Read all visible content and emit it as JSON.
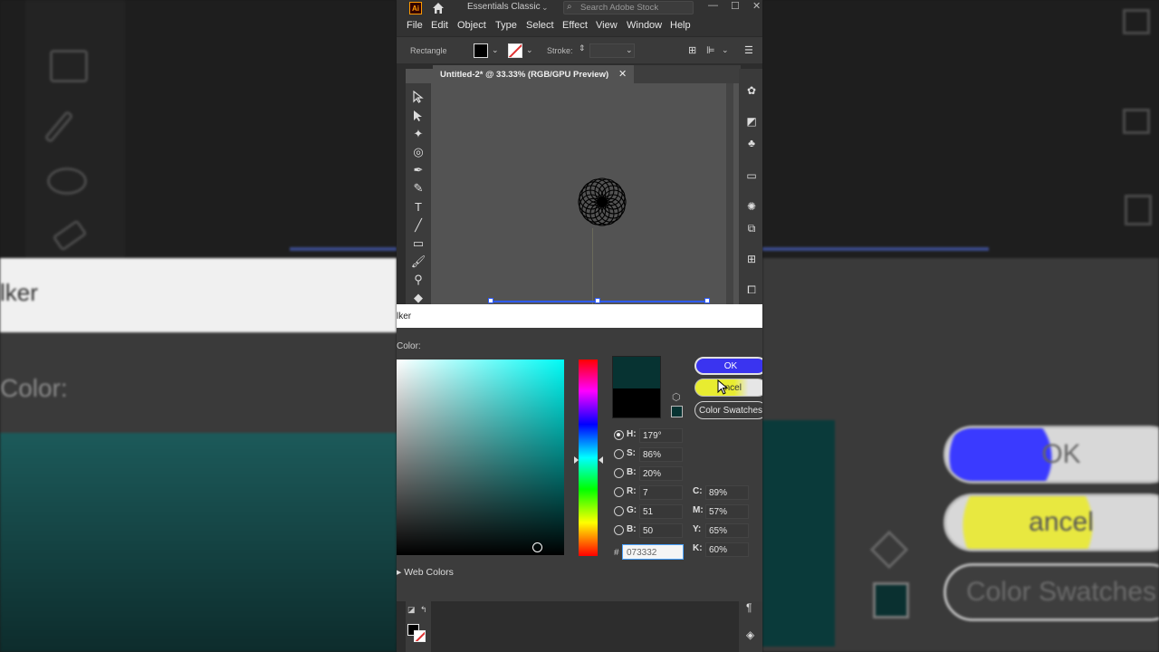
{
  "app": {
    "logo": "Ai",
    "workspace": "Essentials Classic",
    "search_placeholder": "Search Adobe Stock",
    "minimize": "—",
    "maximize": "☐",
    "close": "✕"
  },
  "menu": [
    "File",
    "Edit",
    "Object",
    "Type",
    "Select",
    "Effect",
    "View",
    "Window",
    "Help"
  ],
  "control_bar": {
    "selection_label": "Rectangle",
    "stroke_label": "Stroke:"
  },
  "document_tab": {
    "title": "Untitled-2* @ 33.33% (RGB/GPU Preview)",
    "close": "✕"
  },
  "color_picker": {
    "title": "lker",
    "select_color_label": "Color:",
    "fields": {
      "H": "179°",
      "S": "86%",
      "B": "20%",
      "R": "7",
      "G": "51",
      "Bv": "50",
      "C": "89%",
      "M": "57%",
      "Y": "65%",
      "K": "60%"
    },
    "labels": {
      "H": "H:",
      "S": "S:",
      "B": "B:",
      "R": "R:",
      "G": "G:",
      "Bv": "B:",
      "C": "C:",
      "M": "M:",
      "Y": "Y:",
      "K": "K:",
      "hash": "#"
    },
    "hex": "073332",
    "only_web_colors": "Web Colors",
    "ok": "OK",
    "cancel": "ancel",
    "color_swatches": "Color Swatches",
    "new_color": "#073332",
    "old_color": "#000000"
  },
  "background_zoom": {
    "left_title": "lker",
    "left_label": "Color:",
    "ok": "OK",
    "cancel": "ancel",
    "swatches": "Color Swatches"
  },
  "colors": {
    "accent_ok": "#3a34f0",
    "highlight": "#e8ec30",
    "selection": "#2f5cff"
  }
}
